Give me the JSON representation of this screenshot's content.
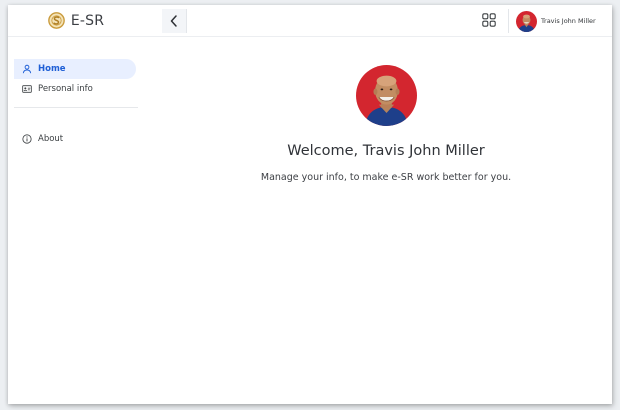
{
  "app": {
    "name": "E-SR"
  },
  "sidebar": {
    "items": [
      {
        "label": "Home",
        "icon": "person-icon",
        "active": true
      },
      {
        "label": "Personal info",
        "icon": "id-card-icon",
        "active": false
      },
      {
        "label": "About",
        "icon": "info-icon",
        "active": false
      }
    ]
  },
  "header": {
    "back_icon": "chevron-left-icon",
    "apps_icon": "apps-grid-icon",
    "user_name": "Travis John Miller"
  },
  "main": {
    "welcome": "Welcome, Travis John Miller",
    "tagline": "Manage your info, to make e-SR work better for you."
  },
  "colors": {
    "accent": "#1f5fd6",
    "active_bg": "#e8efff",
    "avatar_bg": "#d3262f",
    "brand_gold": "#c99a3a"
  }
}
